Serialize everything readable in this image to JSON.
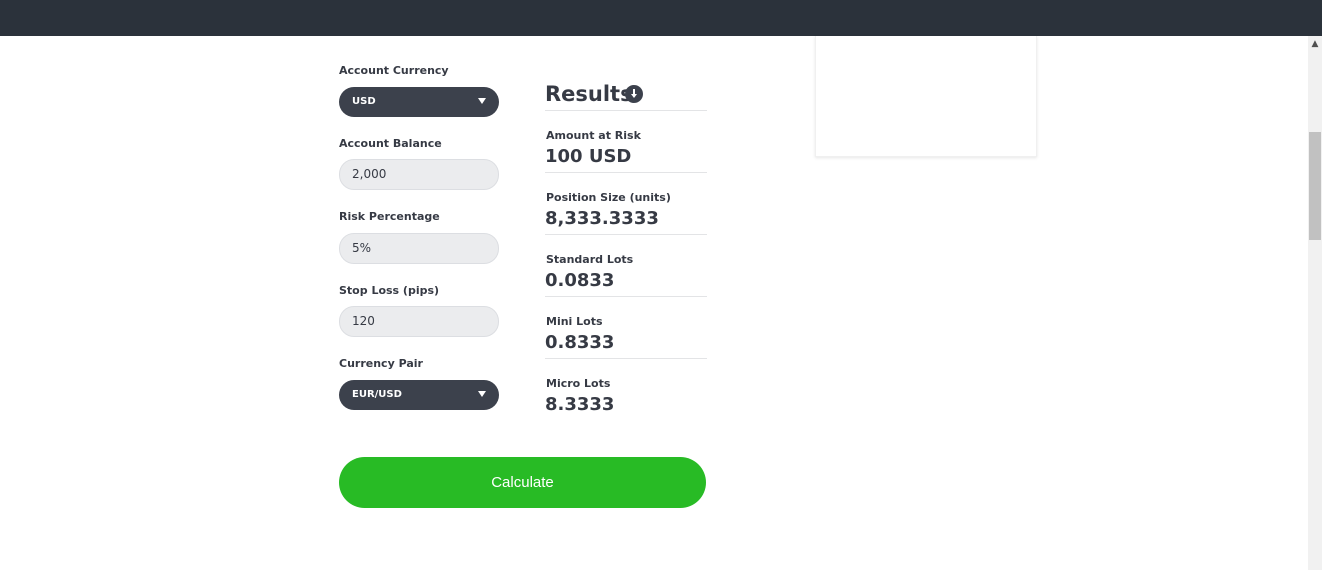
{
  "form": {
    "account_currency": {
      "label": "Account Currency",
      "value": "USD"
    },
    "account_balance": {
      "label": "Account Balance",
      "value": "2,000"
    },
    "risk_percentage": {
      "label": "Risk Percentage",
      "value": "5%"
    },
    "stop_loss": {
      "label": "Stop Loss (pips)",
      "value": "120"
    },
    "currency_pair": {
      "label": "Currency Pair",
      "value": "EUR/USD"
    },
    "calculate_label": "Calculate"
  },
  "results": {
    "title": "Results",
    "amount_at_risk": {
      "label": "Amount at Risk",
      "value": "100 USD"
    },
    "position_size": {
      "label": "Position Size (units)",
      "value": "8,333.3333"
    },
    "standard_lots": {
      "label": "Standard Lots",
      "value": "0.0833"
    },
    "mini_lots": {
      "label": "Mini Lots",
      "value": "0.8333"
    },
    "micro_lots": {
      "label": "Micro Lots",
      "value": "8.3333"
    }
  },
  "colors": {
    "topbar": "#2b323b",
    "select_bg": "#3c414c",
    "input_bg": "#ebecee",
    "button": "#28bb25",
    "text": "#363a44"
  },
  "icons": {
    "info": "info-down-arrow-icon",
    "select_caret": "caret-down-icon",
    "scroll_up": "scroll-up-arrow-icon"
  }
}
